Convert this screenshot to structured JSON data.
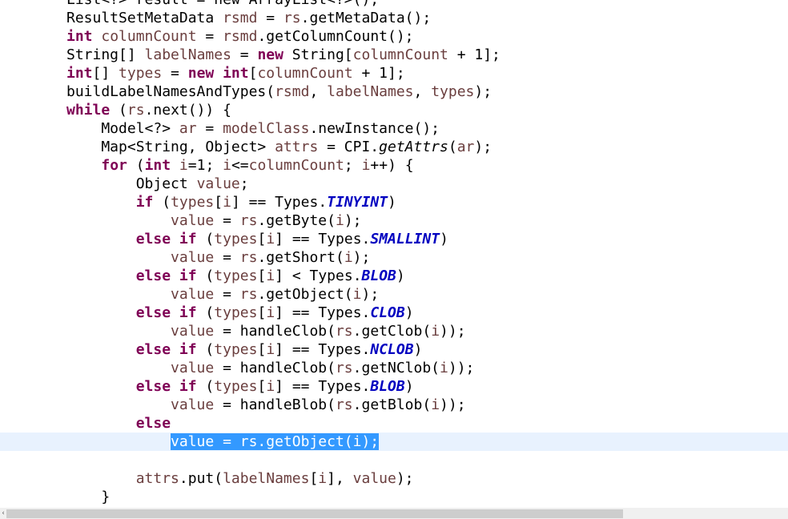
{
  "editor": {
    "lines": [
      [
        {
          "t": "List<?> result = new ArrayList<?>();",
          "c": ""
        }
      ],
      [
        {
          "t": "ResultSetMetaData ",
          "c": ""
        },
        {
          "t": "rsmd",
          "c": "var"
        },
        {
          "t": " = ",
          "c": ""
        },
        {
          "t": "rs",
          "c": "var"
        },
        {
          "t": ".getMetaData();",
          "c": ""
        }
      ],
      [
        {
          "t": "int",
          "c": "kw"
        },
        {
          "t": " ",
          "c": ""
        },
        {
          "t": "columnCount",
          "c": "var"
        },
        {
          "t": " = ",
          "c": ""
        },
        {
          "t": "rsmd",
          "c": "var"
        },
        {
          "t": ".getColumnCount();",
          "c": ""
        }
      ],
      [
        {
          "t": "String[] ",
          "c": ""
        },
        {
          "t": "labelNames",
          "c": "var"
        },
        {
          "t": " = ",
          "c": ""
        },
        {
          "t": "new",
          "c": "kw"
        },
        {
          "t": " String[",
          "c": ""
        },
        {
          "t": "columnCount",
          "c": "var"
        },
        {
          "t": " + 1];",
          "c": ""
        }
      ],
      [
        {
          "t": "int",
          "c": "kw"
        },
        {
          "t": "[] ",
          "c": ""
        },
        {
          "t": "types",
          "c": "var"
        },
        {
          "t": " = ",
          "c": ""
        },
        {
          "t": "new",
          "c": "kw"
        },
        {
          "t": " ",
          "c": ""
        },
        {
          "t": "int",
          "c": "kw"
        },
        {
          "t": "[",
          "c": ""
        },
        {
          "t": "columnCount",
          "c": "var"
        },
        {
          "t": " + 1];",
          "c": ""
        }
      ],
      [
        {
          "t": "buildLabelNamesAndTypes(",
          "c": ""
        },
        {
          "t": "rsmd",
          "c": "var"
        },
        {
          "t": ", ",
          "c": ""
        },
        {
          "t": "labelNames",
          "c": "var"
        },
        {
          "t": ", ",
          "c": ""
        },
        {
          "t": "types",
          "c": "var"
        },
        {
          "t": ");",
          "c": ""
        }
      ],
      [
        {
          "t": "while",
          "c": "kw"
        },
        {
          "t": " (",
          "c": ""
        },
        {
          "t": "rs",
          "c": "var"
        },
        {
          "t": ".next()) {",
          "c": ""
        }
      ],
      [
        {
          "t": "    Model<?> ",
          "c": ""
        },
        {
          "t": "ar",
          "c": "var"
        },
        {
          "t": " = ",
          "c": ""
        },
        {
          "t": "modelClass",
          "c": "var"
        },
        {
          "t": ".newInstance();",
          "c": ""
        }
      ],
      [
        {
          "t": "    Map<String, Object> ",
          "c": ""
        },
        {
          "t": "attrs",
          "c": "var"
        },
        {
          "t": " = CPI.",
          "c": ""
        },
        {
          "t": "getAttrs",
          "c": "static-method"
        },
        {
          "t": "(",
          "c": ""
        },
        {
          "t": "ar",
          "c": "var"
        },
        {
          "t": ");",
          "c": ""
        }
      ],
      [
        {
          "t": "    ",
          "c": ""
        },
        {
          "t": "for",
          "c": "kw"
        },
        {
          "t": " (",
          "c": ""
        },
        {
          "t": "int",
          "c": "kw"
        },
        {
          "t": " ",
          "c": ""
        },
        {
          "t": "i",
          "c": "var"
        },
        {
          "t": "=1; ",
          "c": ""
        },
        {
          "t": "i",
          "c": "var"
        },
        {
          "t": "<=",
          "c": ""
        },
        {
          "t": "columnCount",
          "c": "var"
        },
        {
          "t": "; ",
          "c": ""
        },
        {
          "t": "i",
          "c": "var"
        },
        {
          "t": "++) {",
          "c": ""
        }
      ],
      [
        {
          "t": "        Object ",
          "c": ""
        },
        {
          "t": "value",
          "c": "var"
        },
        {
          "t": ";",
          "c": ""
        }
      ],
      [
        {
          "t": "        ",
          "c": ""
        },
        {
          "t": "if",
          "c": "kw"
        },
        {
          "t": " (",
          "c": ""
        },
        {
          "t": "types",
          "c": "var"
        },
        {
          "t": "[",
          "c": ""
        },
        {
          "t": "i",
          "c": "var"
        },
        {
          "t": "] == Types.",
          "c": ""
        },
        {
          "t": "TINYINT",
          "c": "field"
        },
        {
          "t": ")",
          "c": ""
        }
      ],
      [
        {
          "t": "            ",
          "c": ""
        },
        {
          "t": "value",
          "c": "var"
        },
        {
          "t": " = ",
          "c": ""
        },
        {
          "t": "rs",
          "c": "var"
        },
        {
          "t": ".getByte(",
          "c": ""
        },
        {
          "t": "i",
          "c": "var"
        },
        {
          "t": ");",
          "c": ""
        }
      ],
      [
        {
          "t": "        ",
          "c": ""
        },
        {
          "t": "else",
          "c": "kw"
        },
        {
          "t": " ",
          "c": ""
        },
        {
          "t": "if",
          "c": "kw"
        },
        {
          "t": " (",
          "c": ""
        },
        {
          "t": "types",
          "c": "var"
        },
        {
          "t": "[",
          "c": ""
        },
        {
          "t": "i",
          "c": "var"
        },
        {
          "t": "] == Types.",
          "c": ""
        },
        {
          "t": "SMALLINT",
          "c": "field"
        },
        {
          "t": ")",
          "c": ""
        }
      ],
      [
        {
          "t": "            ",
          "c": ""
        },
        {
          "t": "value",
          "c": "var"
        },
        {
          "t": " = ",
          "c": ""
        },
        {
          "t": "rs",
          "c": "var"
        },
        {
          "t": ".getShort(",
          "c": ""
        },
        {
          "t": "i",
          "c": "var"
        },
        {
          "t": ");",
          "c": ""
        }
      ],
      [
        {
          "t": "        ",
          "c": ""
        },
        {
          "t": "else",
          "c": "kw"
        },
        {
          "t": " ",
          "c": ""
        },
        {
          "t": "if",
          "c": "kw"
        },
        {
          "t": " (",
          "c": ""
        },
        {
          "t": "types",
          "c": "var"
        },
        {
          "t": "[",
          "c": ""
        },
        {
          "t": "i",
          "c": "var"
        },
        {
          "t": "] < Types.",
          "c": ""
        },
        {
          "t": "BLOB",
          "c": "field"
        },
        {
          "t": ")",
          "c": ""
        }
      ],
      [
        {
          "t": "            ",
          "c": ""
        },
        {
          "t": "value",
          "c": "var"
        },
        {
          "t": " = ",
          "c": ""
        },
        {
          "t": "rs",
          "c": "var"
        },
        {
          "t": ".getObject(",
          "c": ""
        },
        {
          "t": "i",
          "c": "var"
        },
        {
          "t": ");",
          "c": ""
        }
      ],
      [
        {
          "t": "        ",
          "c": ""
        },
        {
          "t": "else",
          "c": "kw"
        },
        {
          "t": " ",
          "c": ""
        },
        {
          "t": "if",
          "c": "kw"
        },
        {
          "t": " (",
          "c": ""
        },
        {
          "t": "types",
          "c": "var"
        },
        {
          "t": "[",
          "c": ""
        },
        {
          "t": "i",
          "c": "var"
        },
        {
          "t": "] == Types.",
          "c": ""
        },
        {
          "t": "CLOB",
          "c": "field"
        },
        {
          "t": ")",
          "c": ""
        }
      ],
      [
        {
          "t": "            ",
          "c": ""
        },
        {
          "t": "value",
          "c": "var"
        },
        {
          "t": " = handleClob(",
          "c": ""
        },
        {
          "t": "rs",
          "c": "var"
        },
        {
          "t": ".getClob(",
          "c": ""
        },
        {
          "t": "i",
          "c": "var"
        },
        {
          "t": "));",
          "c": ""
        }
      ],
      [
        {
          "t": "        ",
          "c": ""
        },
        {
          "t": "else",
          "c": "kw"
        },
        {
          "t": " ",
          "c": ""
        },
        {
          "t": "if",
          "c": "kw"
        },
        {
          "t": " (",
          "c": ""
        },
        {
          "t": "types",
          "c": "var"
        },
        {
          "t": "[",
          "c": ""
        },
        {
          "t": "i",
          "c": "var"
        },
        {
          "t": "] == Types.",
          "c": ""
        },
        {
          "t": "NCLOB",
          "c": "field"
        },
        {
          "t": ")",
          "c": ""
        }
      ],
      [
        {
          "t": "            ",
          "c": ""
        },
        {
          "t": "value",
          "c": "var"
        },
        {
          "t": " = handleClob(",
          "c": ""
        },
        {
          "t": "rs",
          "c": "var"
        },
        {
          "t": ".getNClob(",
          "c": ""
        },
        {
          "t": "i",
          "c": "var"
        },
        {
          "t": "));",
          "c": ""
        }
      ],
      [
        {
          "t": "        ",
          "c": ""
        },
        {
          "t": "else",
          "c": "kw"
        },
        {
          "t": " ",
          "c": ""
        },
        {
          "t": "if",
          "c": "kw"
        },
        {
          "t": " (",
          "c": ""
        },
        {
          "t": "types",
          "c": "var"
        },
        {
          "t": "[",
          "c": ""
        },
        {
          "t": "i",
          "c": "var"
        },
        {
          "t": "] == Types.",
          "c": ""
        },
        {
          "t": "BLOB",
          "c": "field"
        },
        {
          "t": ")",
          "c": ""
        }
      ],
      [
        {
          "t": "            ",
          "c": ""
        },
        {
          "t": "value",
          "c": "var"
        },
        {
          "t": " = handleBlob(",
          "c": ""
        },
        {
          "t": "rs",
          "c": "var"
        },
        {
          "t": ".getBlob(",
          "c": ""
        },
        {
          "t": "i",
          "c": "var"
        },
        {
          "t": "));",
          "c": ""
        }
      ],
      [
        {
          "t": "        ",
          "c": ""
        },
        {
          "t": "else",
          "c": "kw"
        }
      ],
      [
        {
          "t": "            ",
          "c": ""
        },
        {
          "t": "value = rs.getObject(i);",
          "c": "sel"
        }
      ],
      [],
      [
        {
          "t": "        ",
          "c": ""
        },
        {
          "t": "attrs",
          "c": "var"
        },
        {
          "t": ".put(",
          "c": ""
        },
        {
          "t": "labelNames",
          "c": "var"
        },
        {
          "t": "[",
          "c": ""
        },
        {
          "t": "i",
          "c": "var"
        },
        {
          "t": "], ",
          "c": ""
        },
        {
          "t": "value",
          "c": "var"
        },
        {
          "t": ");",
          "c": ""
        }
      ],
      [
        {
          "t": "    }",
          "c": ""
        }
      ]
    ],
    "current_line_index": 24
  },
  "scrollbar": {
    "left_arrow": "‹"
  },
  "colors": {
    "keyword": "#7f0055",
    "local_variable": "#6a3e3e",
    "static_field": "#0000c0",
    "selection": "#3399ff",
    "current_line": "#e8f2fe"
  }
}
